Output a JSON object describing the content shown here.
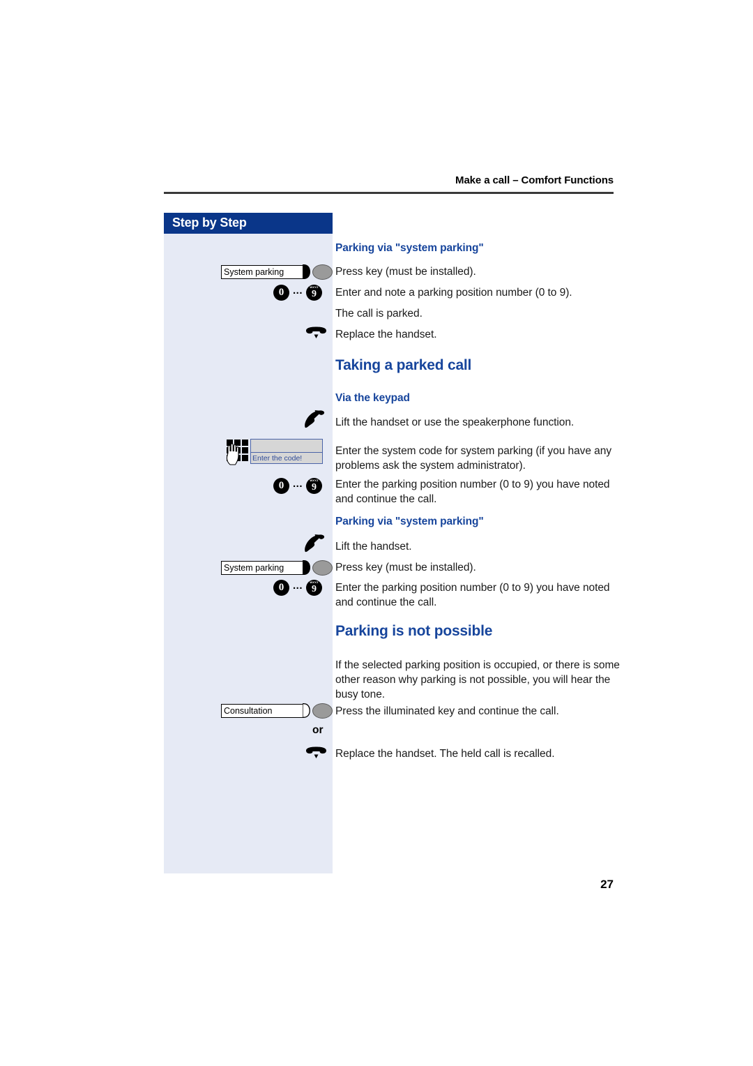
{
  "header": {
    "running_title": "Make a call – Comfort Functions"
  },
  "sidebar": {
    "title": "Step by Step",
    "or_label": "or",
    "keys": {
      "system_parking_1": "System parking",
      "system_parking_2": "System parking",
      "consultation": "Consultation"
    },
    "digits": {
      "from": "0",
      "to": "9",
      "to_letters": "WXYZ",
      "ellipsis": "..."
    },
    "display_widget": {
      "prompt": "Enter the code!"
    },
    "icons": {
      "lift_handset": "lift-handset-icon",
      "replace_handset": "replace-handset-icon",
      "keypad": "keypad-hand-icon",
      "lamp": "key-lamp-icon"
    }
  },
  "content": {
    "block1": {
      "heading": "Parking via \"system parking\"",
      "line1": "Press key (must be installed).",
      "line2": "Enter and note a parking position number (0 to 9).",
      "line3": "The call is parked.",
      "line4": "Replace the handset."
    },
    "section_taking": {
      "heading": "Taking a parked call",
      "sub1": "Via the keypad",
      "sub1_line1": "Lift the handset or use the speakerphone function.",
      "sub1_line2": "Enter the system code for system parking (if you have any problems ask the system administrator).",
      "sub1_line3": "Enter the parking position number (0 to 9) you have noted and continue the call.",
      "sub2": "Parking via \"system parking\"",
      "sub2_line1": "Lift the handset.",
      "sub2_line2": "Press key (must be installed).",
      "sub2_line3": "Enter the parking position number (0 to 9) you have noted and continue the call."
    },
    "section_notpossible": {
      "heading": "Parking is not possible",
      "para": "If the selected parking position is occupied, or there is some other reason why parking is not possible, you will hear the busy tone.",
      "line1": "Press the illuminated key and continue the call.",
      "line2": "Replace the handset. The held call is recalled."
    }
  },
  "footer": {
    "page_number": "27"
  },
  "colors": {
    "brand_blue": "#17459c",
    "header_bar_blue": "#0a3689",
    "sidebar_bg": "#e6eaf5"
  }
}
